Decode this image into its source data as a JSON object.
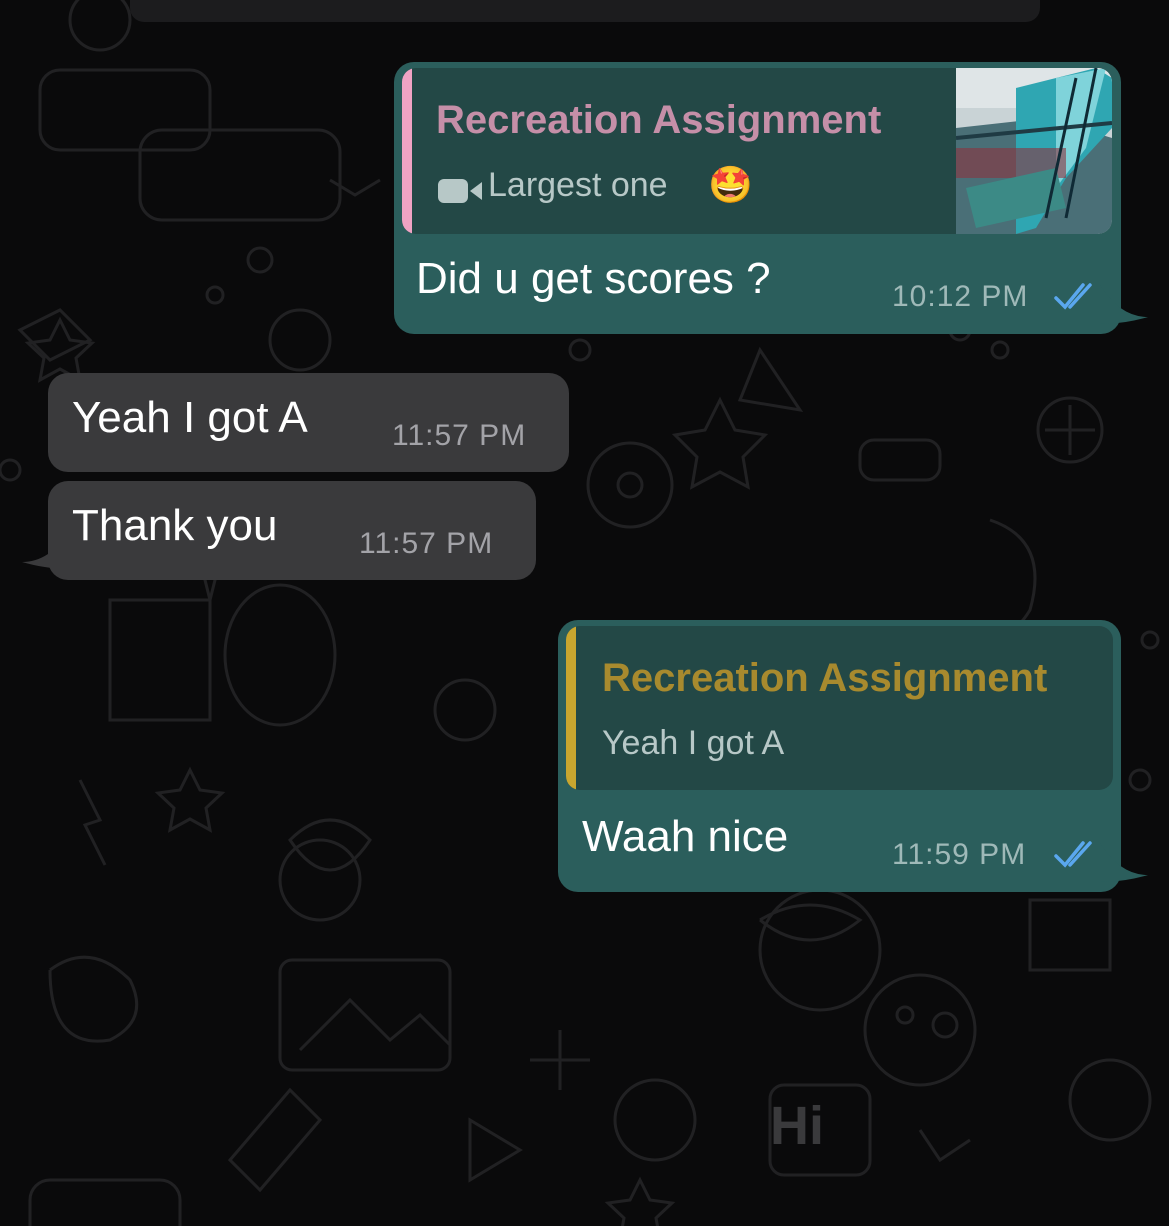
{
  "colors": {
    "outgoing_bubble": "#2b5e5c",
    "incoming_bubble": "#3a3a3c",
    "quote_pink": "#c07f9a",
    "quote_gold": "#a88a2e",
    "read_ticks": "#5aa7ee"
  },
  "messages": [
    {
      "direction": "outgoing",
      "reply": {
        "title": "Recreation Assignment",
        "icon": "video-camera-icon",
        "subtitle": "Largest one",
        "emoji": "🤩",
        "has_thumbnail": true
      },
      "text": "Did u get scores ?",
      "time": "10:12 PM",
      "status": "read"
    },
    {
      "direction": "incoming",
      "text": "Yeah I got A",
      "time": "11:57 PM"
    },
    {
      "direction": "incoming",
      "text": "Thank you",
      "time": "11:57 PM"
    },
    {
      "direction": "outgoing",
      "reply": {
        "title": "Recreation Assignment",
        "subtitle": "Yeah I got A"
      },
      "text": "Waah nice",
      "time": "11:59 PM",
      "status": "read"
    }
  ],
  "wallpaper_doodle": "Hi"
}
